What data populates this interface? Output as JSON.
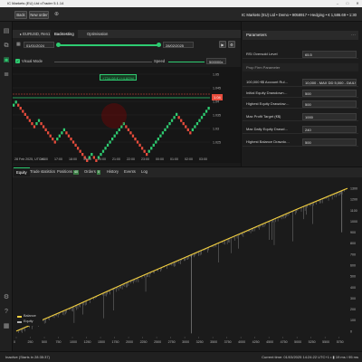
{
  "window": {
    "title": "IC Markets (EU) Ltd cTrader 5.1.14"
  },
  "toolbar": {
    "back_label": "Back",
    "new_order_label": "New order"
  },
  "account": {
    "text": "IC Markets (EU) Ltd • Demo • 9058917 • Hedging • € 1,586.69 • 1:30"
  },
  "symbol_tabs": [
    {
      "label": "EURUSD, Ren1"
    },
    {
      "label": "Backtesting"
    },
    {
      "label": "Optimisation"
    }
  ],
  "dates": {
    "start": "01/01/2024",
    "end": "28/02/2025"
  },
  "visual_mode": {
    "label": "Visual Mode",
    "speed_label": "Speed",
    "speed_value": "500000x"
  },
  "chart_labels": {
    "price_tag": "+734.08 € (+4.60%)",
    "last_price_tag": "1.04"
  },
  "top_chart": {
    "price_ticks": [
      "1.05",
      "1.045",
      "1.04",
      "1.035",
      "1.03",
      "1.025"
    ],
    "time_ticks": [
      "28 Feb 2025, UTC+1",
      "16:00",
      "17:00",
      "18:00",
      "19:00",
      "20:00",
      "21:00",
      "22:00",
      "23:00",
      "00:00",
      "01:00",
      "02:00",
      "03:00"
    ],
    "colors": {
      "up": "#2ecc71",
      "down": "#e74c3c",
      "level_line": "#2ecc71"
    }
  },
  "parameters": {
    "header": "Parameters",
    "rows_top": [
      {
        "label": "RSI Oversold Level",
        "value": "65.5"
      }
    ],
    "section": "Prop Firm Parameter",
    "rows": [
      {
        "label": "100,000 €$ Account Rul…",
        "value": "10,000 - MAX DD 5,000 - DAILY DD"
      },
      {
        "label": "Initial Equity Drawdown…",
        "value": "500"
      },
      {
        "label": "Highest Equity Drawdow…",
        "value": "500"
      },
      {
        "label": "Max Profit Target (€$)",
        "value": "1000"
      },
      {
        "label": "Max Daily Equity Drawd…",
        "value": "240"
      },
      {
        "label": "Highest Balance Drawdo…",
        "value": "500"
      }
    ]
  },
  "bottom_tabs": [
    {
      "label": "Equity"
    },
    {
      "label": "Trade statistics"
    },
    {
      "label": "Positions",
      "badge": "40"
    },
    {
      "label": "Orders",
      "badge": "0"
    },
    {
      "label": "History"
    },
    {
      "label": "Events"
    },
    {
      "label": "Log"
    }
  ],
  "chart_data": {
    "type": "line",
    "series": [
      {
        "name": "Balance",
        "color": "#f4d03f"
      },
      {
        "name": "Equity",
        "color": "#b0b0b0"
      }
    ],
    "x_ticks": [
      "0",
      "250",
      "500",
      "750",
      "1000",
      "1250",
      "1500",
      "1750",
      "2000",
      "2250",
      "2500",
      "2750",
      "3000",
      "3250",
      "3500",
      "3750",
      "4000",
      "4250",
      "4500",
      "4750",
      "5000",
      "5250",
      "5500",
      "5750"
    ],
    "y_ticks": [
      "1300",
      "1200",
      "1100",
      "1000",
      "900",
      "800",
      "700",
      "600",
      "500",
      "400",
      "300",
      "200",
      "100",
      "0"
    ],
    "xlim": [
      0,
      5900
    ],
    "ylim": [
      -50,
      1350
    ],
    "balance": {
      "x": [
        0,
        1000,
        2000,
        3000,
        4000,
        5000,
        5900
      ],
      "y": [
        0,
        220,
        450,
        670,
        890,
        1110,
        1300
      ]
    }
  },
  "status": {
    "left": "Inactive (Starts in 28:35:37)",
    "right": "Current time: 01/03/2025 14:24:22  UTC+1  •  ▮  19 ms / 95 ms"
  }
}
